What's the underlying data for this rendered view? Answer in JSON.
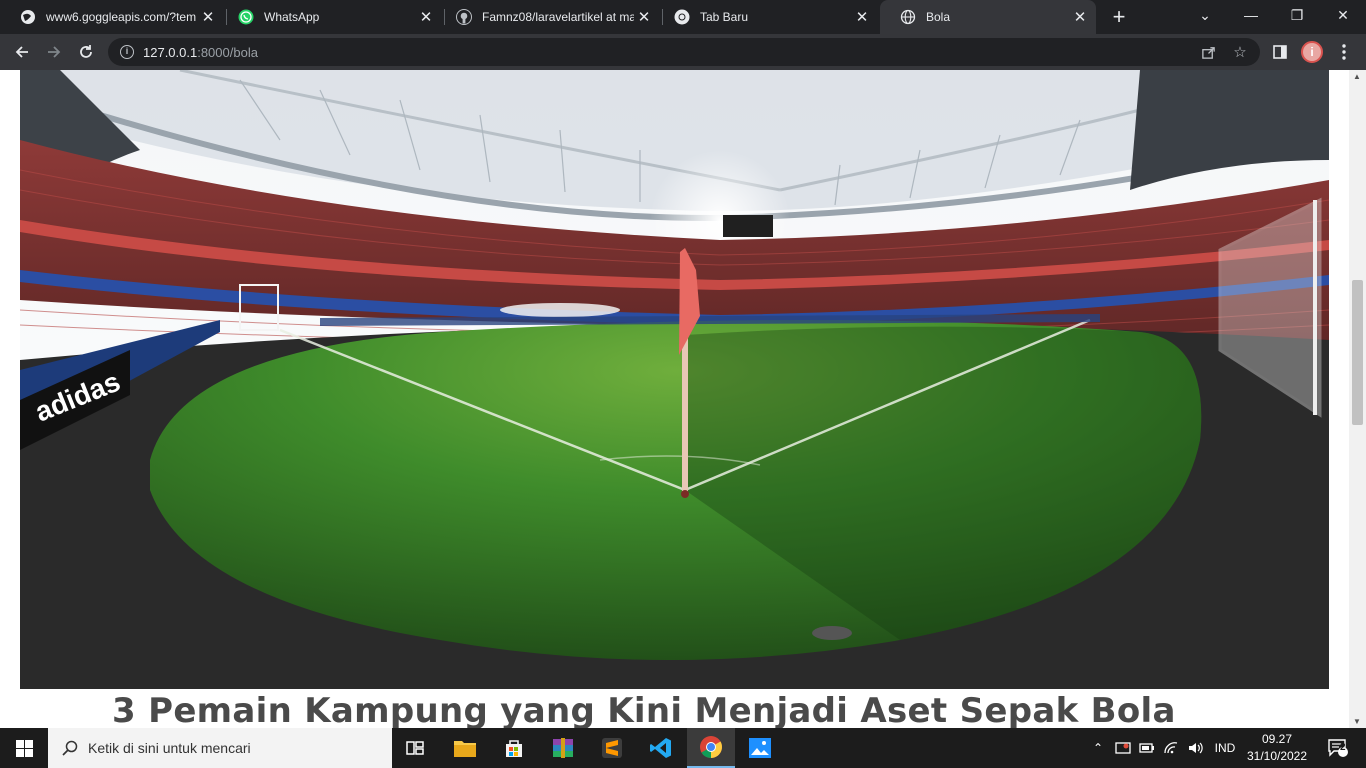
{
  "browser": {
    "tabs": [
      {
        "title": "www6.goggleapis.com/?tem",
        "icon": "globe-icon"
      },
      {
        "title": "WhatsApp",
        "icon": "whatsapp-icon"
      },
      {
        "title": "Famnz08/laravelartikel at ma",
        "icon": "github-icon"
      },
      {
        "title": "Tab Baru",
        "icon": "chrome-icon"
      },
      {
        "title": "Bola",
        "icon": "globe-icon",
        "active": true
      }
    ],
    "url_host": "127.0.0.1",
    "url_path": ":8000/bola"
  },
  "page": {
    "hero_alt": "stadium-photo",
    "article_title": "3 Pemain Kampung yang Kini Menjadi Aset Sepak Bola"
  },
  "taskbar": {
    "search_placeholder": "Ketik di sini untuk mencari",
    "language": "IND",
    "time": "09.27",
    "date": "31/10/2022",
    "notification_count": "2"
  },
  "colors": {
    "tab_bg": "#202124",
    "toolbar_bg": "#35363a",
    "taskbar_bg": "#1c1c1c",
    "pitch_green": "#3f8c2b",
    "seat_red": "#a83a36"
  }
}
